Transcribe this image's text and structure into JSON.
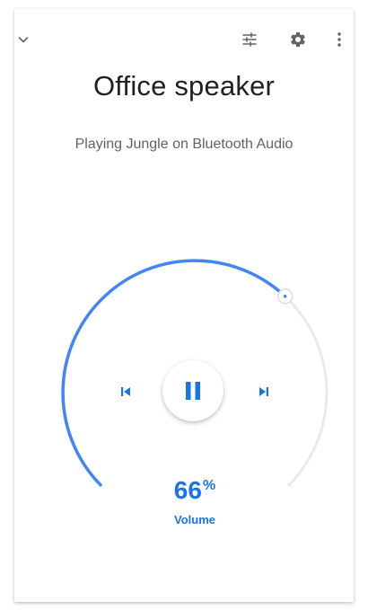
{
  "header": {
    "collapse_icon": "chevron-down-icon",
    "eq_icon": "tune-icon",
    "settings_icon": "gear-icon",
    "more_icon": "more-vert-icon"
  },
  "device": {
    "name": "Office speaker",
    "status": "Playing Jungle on Bluetooth Audio"
  },
  "volume": {
    "level": 0.66,
    "value": "66",
    "unit": "%",
    "label": "Volume"
  },
  "controls": {
    "previous_icon": "skip-previous-icon",
    "pause_icon": "pause-icon",
    "next_icon": "skip-next-icon"
  },
  "colors": {
    "accent": "#4285f4",
    "accent_text": "#1a73e8",
    "track": "#e8eaed",
    "icon_gray": "#5f6368"
  }
}
